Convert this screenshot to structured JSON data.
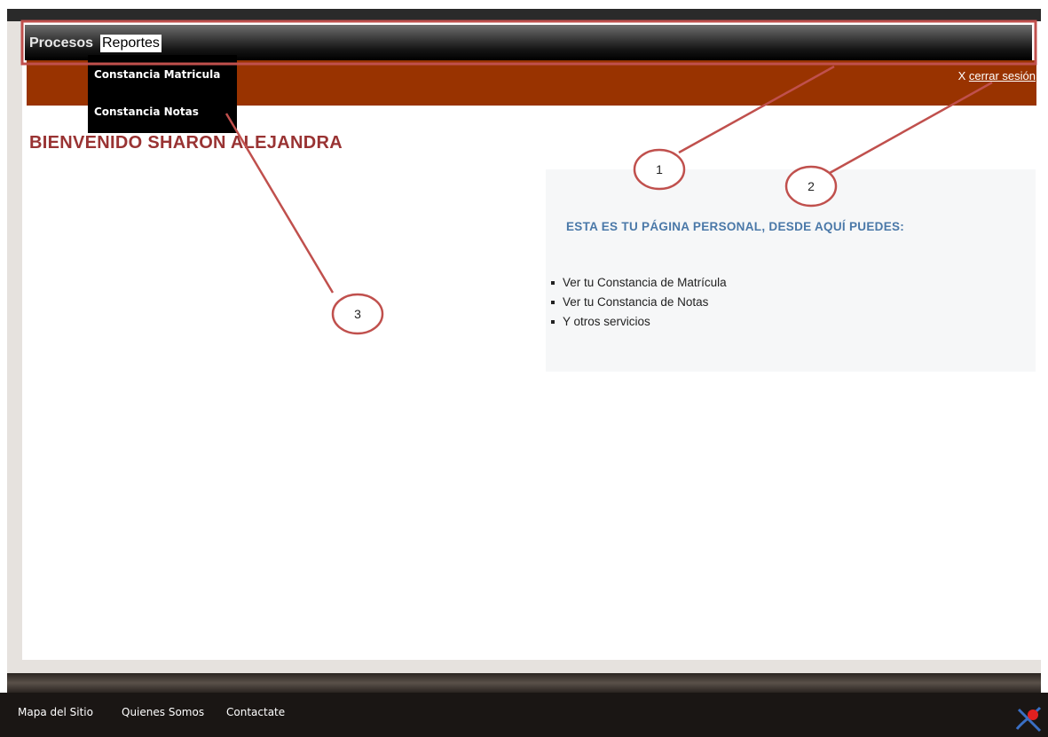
{
  "menu": {
    "procesos": "Procesos",
    "reportes": "Reportes"
  },
  "dropdown": {
    "items": [
      {
        "label": "Constancia Matricula"
      },
      {
        "label": "Constancia Notas"
      }
    ]
  },
  "header": {
    "logout_x": "X",
    "logout_label": "cerrar sesión"
  },
  "welcome": "BIENVENIDO SHARON ALEJANDRA",
  "panel": {
    "title": "ESTA ES TU PÁGINA PERSONAL, DESDE AQUÍ PUEDES:",
    "items": [
      "Ver tu Constancia de Matrícula",
      "Ver tu Constancia de Notas",
      "Y otros servicios"
    ]
  },
  "footer": {
    "links": [
      "Mapa del Sitio",
      "Quienes Somos",
      "Contactate"
    ]
  },
  "annotations": {
    "callouts": [
      "1",
      "2",
      "3"
    ],
    "color": "#c0504d"
  },
  "colors": {
    "banner": "#993300",
    "welcome": "#993333",
    "panel_title": "#4a78a8"
  }
}
